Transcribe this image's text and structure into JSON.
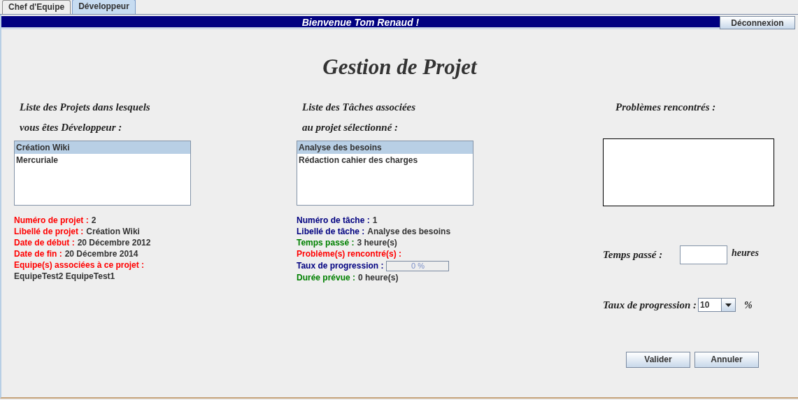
{
  "tabs": [
    {
      "label": "Chef d'Equipe",
      "selected": false
    },
    {
      "label": "Développeur",
      "selected": true
    }
  ],
  "banner": {
    "welcome": "Bienvenue Tom Renaud !",
    "logout_button": "Déconnexion"
  },
  "title": "Gestion de Projet",
  "projects": {
    "heading": [
      "Liste des Projets dans lesquels",
      "vous êtes Développeur :"
    ],
    "items": [
      {
        "label": "Création Wiki",
        "selected": true
      },
      {
        "label": "Mercuriale",
        "selected": false
      }
    ],
    "info": [
      {
        "label": "Numéro de projet :",
        "value": "2",
        "color": "#ff0000"
      },
      {
        "label": "Libellé de projet :",
        "value": "Création Wiki",
        "color": "#ff0000"
      },
      {
        "label": "Date de début :",
        "value": "20 Décembre 2012",
        "color": "#ff0000"
      },
      {
        "label": "Date de fin :",
        "value": "20 Décembre 2014",
        "color": "#ff0000"
      },
      {
        "label": "Equipe(s) associées à ce projet :",
        "color": "#ff0000"
      }
    ],
    "teams": "EquipeTest2 EquipeTest1"
  },
  "tasks": {
    "heading": [
      "Liste des Tâches associées",
      "au projet sélectionné :"
    ],
    "items": [
      {
        "label": "Analyse des besoins",
        "selected": true
      },
      {
        "label": "Rédaction cahier des charges",
        "selected": false
      }
    ],
    "info": [
      {
        "kind": "text",
        "label": "Numéro de tâche :",
        "value": "1",
        "color": "#000080"
      },
      {
        "kind": "text",
        "label": "Libellé de tâche :",
        "value": "Analyse des besoins",
        "color": "#000080"
      },
      {
        "kind": "text",
        "label": "Temps passé :",
        "value": "3 heure(s)",
        "color": "#008000"
      },
      {
        "kind": "text",
        "label": "Problème(s) rencontré(s) :",
        "color": "#ff0000"
      },
      {
        "kind": "progress",
        "label": "Taux de progression :",
        "level": 0,
        "reading": "0 %",
        "color": "#000080"
      },
      {
        "kind": "text",
        "label": "Durée prévue :",
        "value": "0 heure(s)",
        "color": "#008000"
      }
    ]
  },
  "entry": {
    "problems_label": "Problèmes rencontrés :",
    "time_label": "Temps passé :",
    "time_unit": "heures",
    "progress_label": "Taux de progression :",
    "progress_value": "10",
    "progress_unit": "%",
    "buttons": [
      "Valider",
      "Annuler"
    ]
  }
}
